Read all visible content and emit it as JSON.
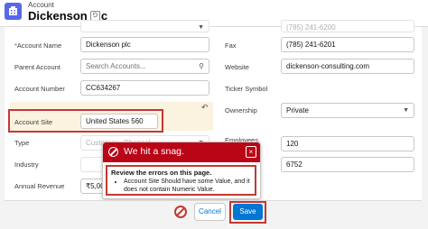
{
  "header": {
    "object_label": "Account",
    "record_name": "Dickenson plc",
    "hierarchy_glyph": "⅁"
  },
  "left_fields": {
    "top_partial": "",
    "account_name": {
      "label": "Account Name",
      "required": "*",
      "value": "Dickenson plc"
    },
    "parent_account": {
      "label": "Parent Account",
      "placeholder": "Search Accounts..."
    },
    "account_number": {
      "label": "Account Number",
      "value": "CC634267"
    },
    "account_site": {
      "label": "Account Site",
      "value": "United States 560"
    },
    "type": {
      "label": "Type",
      "value": "Customer - Channel"
    },
    "industry": {
      "label": "Industry"
    },
    "annual_revenue": {
      "label": "Annual Revenue",
      "value": "₹5,00"
    },
    "email_partial": "",
    "email_value_partial": ""
  },
  "right_fields": {
    "phone_value": "(785) 241-6200",
    "fax": {
      "label": "Fax",
      "value": "(785) 241-6201"
    },
    "website": {
      "label": "Website",
      "value": "dickenson-consulting.com"
    },
    "ticker": {
      "label": "Ticker Symbol"
    },
    "ownership": {
      "label": "Ownership",
      "value": "Private"
    },
    "employees": {
      "label": "Employees",
      "value": "120"
    },
    "sic_value": "6752"
  },
  "error_popover": {
    "title": "We hit a snag.",
    "close_glyph": "×",
    "subtitle": "Review the errors on this page.",
    "message": "Account Site Should have some Value, and it does not contain Numeric Value."
  },
  "footer": {
    "cancel_label": "Cancel",
    "save_label": "Save"
  },
  "colors": {
    "brand_blue": "#0176d3",
    "error_red": "#ba0517",
    "highlight_outline": "#c23934",
    "object_icon": "#5867e8"
  }
}
